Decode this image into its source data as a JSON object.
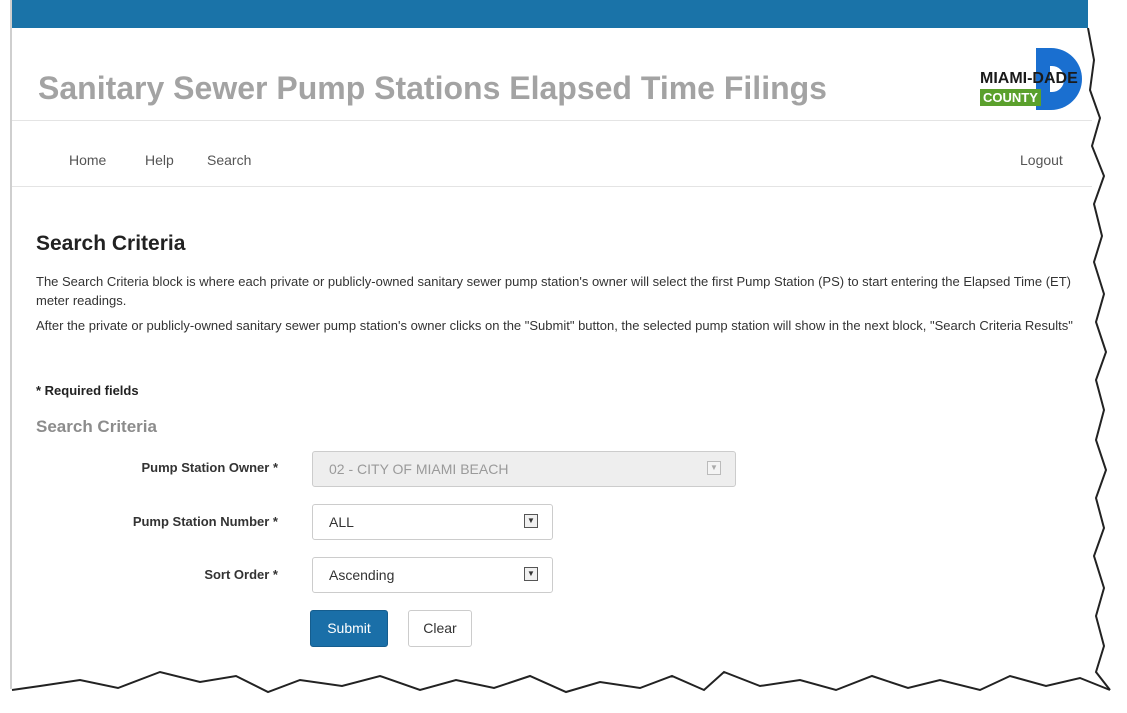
{
  "header": {
    "title": "Sanitary Sewer Pump Stations Elapsed Time Filings",
    "logo": {
      "line1": "MIAMI-DADE",
      "line2": "COUNTY",
      "brand_blue": "#1a6fd0",
      "brand_green": "#5aa02c"
    }
  },
  "nav": {
    "home": "Home",
    "help": "Help",
    "search": "Search",
    "logout": "Logout"
  },
  "section": {
    "title": "Search Criteria",
    "desc1": "The Search Criteria block is where each private or publicly-owned sanitary sewer pump station's owner will select the first Pump Station (PS) to start entering the Elapsed Time (ET) meter readings.",
    "desc2": "After the private or publicly-owned sanitary sewer pump station's owner clicks on the \"Submit\" button, the selected pump station will show in the next block, \"Search Criteria Results\"",
    "required_note": "* Required fields",
    "subsection_title": "Search Criteria"
  },
  "form": {
    "owner_label": "Pump Station Owner *",
    "owner_value": "02 - CITY OF MIAMI BEACH",
    "number_label": "Pump Station Number *",
    "number_value": "ALL",
    "sort_label": "Sort Order *",
    "sort_value": "Ascending",
    "submit": "Submit",
    "clear": "Clear"
  },
  "colors": {
    "topbar": "#1a73a8",
    "primary_button": "#1a6fa8",
    "title_gray": "#a3a3a3"
  }
}
